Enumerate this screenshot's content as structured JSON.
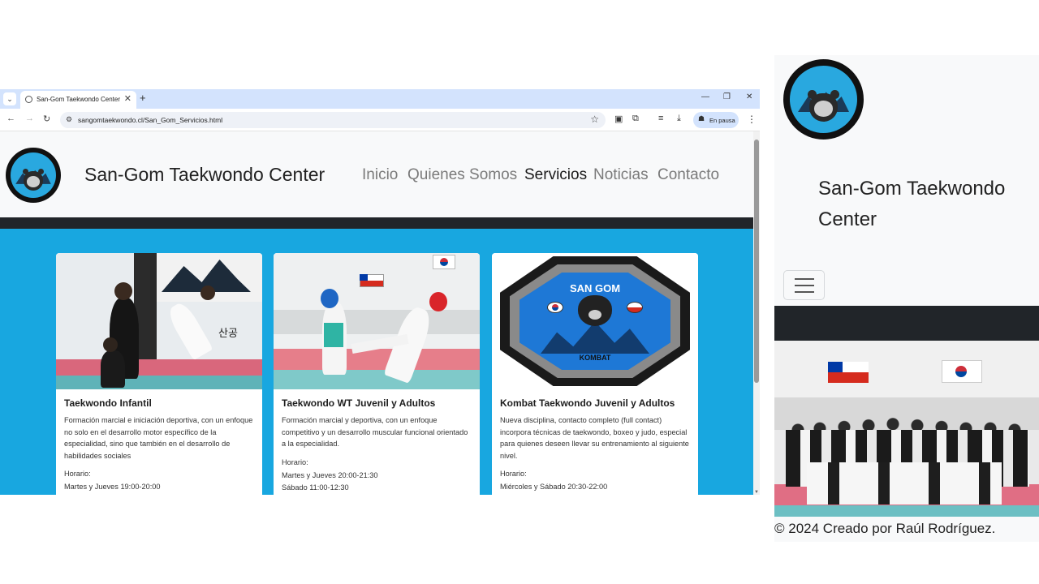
{
  "browser": {
    "tab_title": "San-Gom Taekwondo Center",
    "tab_close": "✕",
    "new_tab": "+",
    "url": "sangomtaekwondo.cl/San_Gom_Servicios.html",
    "profile_status": "En pausa",
    "icons": [
      "tab-search-icon",
      "back-icon",
      "forward-icon",
      "reload-icon",
      "site-info-icon",
      "bookmark-star-icon",
      "extension-icon",
      "puzzle-icon",
      "reading-list-icon",
      "download-icon",
      "menu-icon"
    ]
  },
  "site": {
    "brand": "San-Gom Taekwondo Center",
    "nav": [
      {
        "label": "Inicio",
        "active": false
      },
      {
        "label": "Quienes Somos",
        "active": false
      },
      {
        "label": "Servicios",
        "active": true
      },
      {
        "label": "Noticias",
        "active": false
      },
      {
        "label": "Contacto",
        "active": false
      }
    ],
    "colors": {
      "accent_blue": "#18a7e0",
      "dark_band": "#212529",
      "nav_bg": "#f8f9fa"
    }
  },
  "cards": [
    {
      "title": "Taekwondo Infantil",
      "text": "Formación marcial e iniciación deportiva, con un enfoque no solo en el desarrollo motor específico de la especialidad, sino que también en el desarrollo de habilidades sociales",
      "schedule_label": "Horario:",
      "schedule": [
        "Martes y Jueves 19:00-20:00"
      ]
    },
    {
      "title": "Taekwondo WT Juvenil y Adultos",
      "text": "Formación marcial y deportiva, con un enfoque competitivo y un desarrollo muscular funcional orientado a la especialidad.",
      "schedule_label": "Horario:",
      "schedule": [
        "Martes y Jueves 20:00-21:30",
        "Sábado 11:00-12:30"
      ]
    },
    {
      "title": "Kombat Taekwondo Juvenil y Adultos",
      "text": "Nueva disciplina, contacto completo (full contact) incorpora técnicas de taekwondo, boxeo y judo, especial para quienes deseen llevar su entrenamiento al siguiente nivel.",
      "schedule_label": "Horario:",
      "schedule": [
        "Miércoles y Sábado 20:30-22:00"
      ],
      "image_text": {
        "top": "SAN GOM",
        "bottom": "KOMBAT"
      }
    }
  ],
  "mobile": {
    "brand": "San-Gom Taekwondo Center",
    "footer": "© 2024 Creado por Raúl Rodríguez."
  }
}
